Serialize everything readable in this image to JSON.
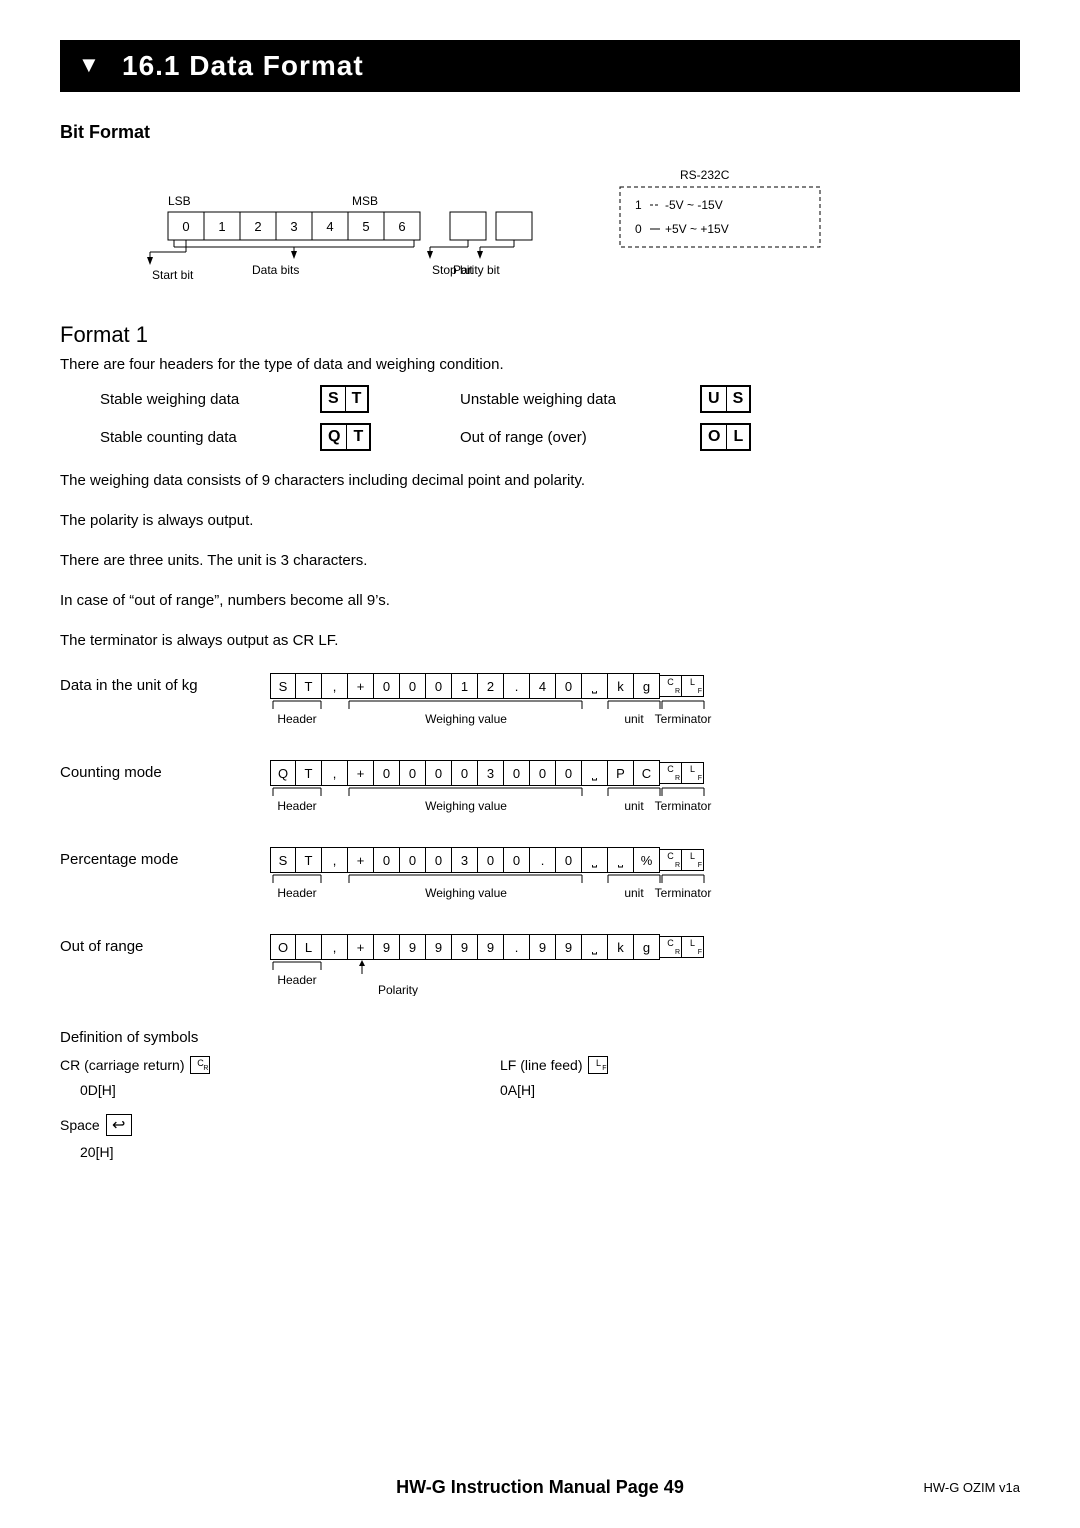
{
  "header": {
    "icon": "▼",
    "title": "16.1   Data Format"
  },
  "bit_format": {
    "section_title": "Bit Format",
    "bit_labels": [
      "LSB",
      "0",
      "1",
      "2",
      "3",
      "4",
      "5",
      "MSB",
      "6"
    ],
    "data_bits_label": "Data bits",
    "start_bit_label": "Start bit",
    "stop_bit_label": "Stop bit",
    "parity_bit_label": "Parity bit",
    "rs232c_label": "RS-232C",
    "level_1_label": "1",
    "level_1_value": "-5V ~ -15V",
    "level_0_label": "0",
    "level_0_value": "+5V ~ +15V"
  },
  "format1": {
    "title": "Format 1",
    "description": "There are four headers for the type of data and weighing condition.",
    "headers": [
      {
        "label": "Stable weighing data",
        "code": [
          "S",
          "T"
        ],
        "right_label": "Unstable weighing data",
        "right_code": [
          "U",
          "S"
        ]
      },
      {
        "label": "Stable counting data",
        "code": [
          "Q",
          "T"
        ],
        "right_label": "Out of range (over)",
        "right_code": [
          "O",
          "L"
        ]
      }
    ]
  },
  "body_texts": [
    "The weighing data consists of 9 characters including decimal point and polarity.",
    "The polarity is always output.",
    "There are three units. The unit is 3 characters.",
    "In case of “out of range”, numbers become all 9’s.",
    "The terminator is always output as CR LF."
  ],
  "data_examples": [
    {
      "label": "Data in the unit of kg",
      "chars": [
        "S",
        "T",
        ",",
        "+",
        "0",
        "0",
        "0",
        "1",
        "2",
        ".",
        "4",
        "0",
        "_",
        "k",
        "g",
        "CR",
        "LF"
      ],
      "annotations": [
        {
          "text": "Header",
          "span": 2
        },
        {
          "text": "Weighing value",
          "span": 9
        },
        {
          "text": "unit",
          "span": 2
        },
        {
          "text": "Terminator",
          "span": 2
        }
      ]
    },
    {
      "label": "Counting mode",
      "chars": [
        "Q",
        "T",
        ",",
        "+",
        "0",
        "0",
        "0",
        "0",
        "3",
        "0",
        "0",
        "0",
        "_",
        "P",
        "C",
        "CR",
        "LF"
      ],
      "annotations": [
        {
          "text": "Header",
          "span": 2
        },
        {
          "text": "Weighing value",
          "span": 9
        },
        {
          "text": "unit",
          "span": 2
        },
        {
          "text": "Terminator",
          "span": 2
        }
      ]
    },
    {
      "label": "Percentage mode",
      "chars": [
        "S",
        "T",
        ",",
        "+",
        "0",
        "0",
        "0",
        "3",
        "0",
        "0",
        ".",
        "0",
        "_",
        "_",
        "%",
        "CR",
        "LF"
      ],
      "annotations": [
        {
          "text": "Header",
          "span": 2
        },
        {
          "text": "Weighing value",
          "span": 9
        },
        {
          "text": "unit",
          "span": 2
        },
        {
          "text": "Terminator",
          "span": 2
        }
      ]
    },
    {
      "label": "Out of range",
      "chars": [
        "O",
        "L",
        ",",
        "+",
        "9",
        "9",
        "9",
        "9",
        "9",
        ".",
        "9",
        "9",
        "_",
        "k",
        "g",
        "CR",
        "LF"
      ],
      "annotations": [
        {
          "text": "Header",
          "span": 2
        },
        {
          "text": "Polarity",
          "span": 1
        }
      ]
    }
  ],
  "def_symbols": {
    "title": "Definition of symbols",
    "cr_label": "CR (carriage return)",
    "cr_code": "CR",
    "cr_hex": "0D[H]",
    "lf_label": "LF (line feed)",
    "lf_code": "LF",
    "lf_hex": "0A[H]",
    "space_label": "Space",
    "space_hex": "20[H]"
  },
  "footer": {
    "main": "HW-G Instruction Manual Page 49",
    "sub": "HW-G OZIM v1a"
  }
}
